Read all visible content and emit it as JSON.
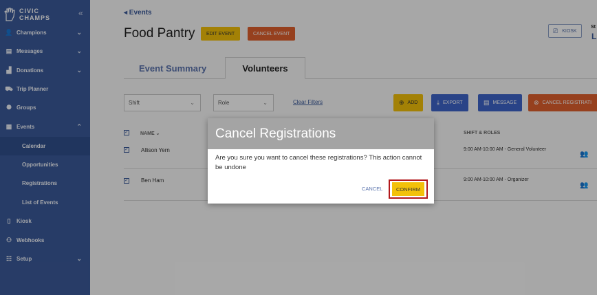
{
  "sidebar": {
    "logo_line1": "CIVIC",
    "logo_line2": "CHAMPS",
    "collapse_icon": "«",
    "items": [
      {
        "label": "Champions",
        "icon": "person-icon",
        "glyph": "👤",
        "chevron": "⌄"
      },
      {
        "label": "Messages",
        "icon": "message-icon",
        "glyph": "▤",
        "chevron": "⌄"
      },
      {
        "label": "Donations",
        "icon": "donation-icon",
        "glyph": "▟",
        "chevron": "⌄"
      },
      {
        "label": "Trip Planner",
        "icon": "car-icon",
        "glyph": "⛟"
      },
      {
        "label": "Groups",
        "icon": "groups-icon",
        "glyph": "⚉"
      },
      {
        "label": "Events",
        "icon": "calendar-icon",
        "glyph": "▦",
        "chevron": "⌃"
      },
      {
        "label": "Kiosk",
        "icon": "tablet-icon",
        "glyph": "▯"
      },
      {
        "label": "Webhooks",
        "icon": "webhook-icon",
        "glyph": "⚇"
      },
      {
        "label": "Setup",
        "icon": "sliders-icon",
        "glyph": "☷",
        "chevron": "⌄"
      }
    ],
    "event_subitems": [
      "Calendar",
      "Opportunities",
      "Registrations",
      "List of Events"
    ]
  },
  "header": {
    "back_label": "◂  Events",
    "title": "Food Pantry",
    "edit_label": "EDIT EVENT",
    "cancel_event_label": "CANCEL EVENT",
    "kiosk_label": "KIOSK",
    "status_label": "St",
    "status_value": "Li"
  },
  "tabs": [
    "Event Summary",
    "Volunteers"
  ],
  "filters": {
    "shift": "Shift",
    "role": "Role",
    "clear": "Clear Filters"
  },
  "actions": {
    "add": "ADD",
    "export": "EXPORT",
    "message": "MESSAGE",
    "cancel_reg": "CANCEL REGISTRATI"
  },
  "table": {
    "name_header": "NAME ⌄",
    "shift_header": "SHIFT & ROLES",
    "rows": [
      {
        "name": "Allison Yern",
        "shift": "9:00 AM-10:00 AM - General Volunteer"
      },
      {
        "name": "Ben Ham",
        "shift": "9:00 AM-10:00 AM - Organizer"
      }
    ]
  },
  "modal": {
    "title": "Cancel Registrations",
    "body": "Are you sure you want to cancel these registrations? This action cannot be undone",
    "cancel": "CANCEL",
    "confirm": "CONFIRM"
  },
  "colors": {
    "sidebar": "#3b5a9a",
    "accent_yellow": "#f3c10a",
    "accent_orange": "#e0602d",
    "accent_blue": "#3e64c9",
    "highlight_border": "#b2181b"
  }
}
